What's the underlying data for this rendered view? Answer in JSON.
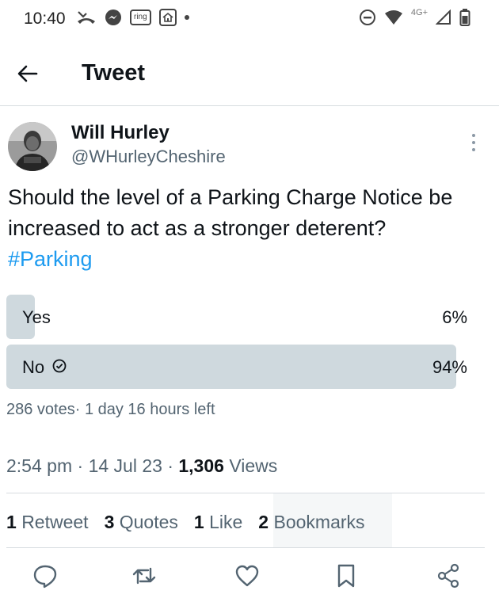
{
  "status_bar": {
    "time": "10:40",
    "left_icons": [
      "missed-call-icon",
      "messenger-icon",
      "ring-icon",
      "home-icon",
      "notification-dot-icon"
    ],
    "ring_label": "ring",
    "network_label": "4G+",
    "right_icons": [
      "do-not-disturb-icon",
      "wifi-icon",
      "signal-icon",
      "battery-icon"
    ]
  },
  "header": {
    "title": "Tweet",
    "back_icon": "back-arrow-icon"
  },
  "tweet": {
    "author_name": "Will Hurley",
    "author_handle": "@WHurleyCheshire",
    "text": "Should the level of a Parking Charge Notice be increased to act as a stronger deterent?",
    "hashtag": "#Parking",
    "poll": {
      "options": [
        {
          "label": "Yes",
          "percent_label": "6%",
          "percent": 6,
          "winner": false
        },
        {
          "label": "No",
          "percent_label": "94%",
          "percent": 94,
          "winner": true
        }
      ],
      "meta": "286 votes· 1 day 16 hours left"
    },
    "time": "2:54 pm",
    "date": "14 Jul 23",
    "views_count": "1,306",
    "views_label": "Views",
    "sep": "·"
  },
  "stats": {
    "retweets_count": "1",
    "retweets_label": "Retweet",
    "quotes_count": "3",
    "quotes_label": "Quotes",
    "likes_count": "1",
    "likes_label": "Like",
    "bookmarks_count": "2",
    "bookmarks_label": "Bookmarks"
  },
  "actions": [
    "reply-icon",
    "retweet-icon",
    "like-icon",
    "bookmark-icon",
    "share-icon"
  ],
  "colors": {
    "accent": "#1d9bf0",
    "poll_fill": "#cfd9de",
    "secondary_text": "#536471",
    "divider": "#d7dce0"
  }
}
